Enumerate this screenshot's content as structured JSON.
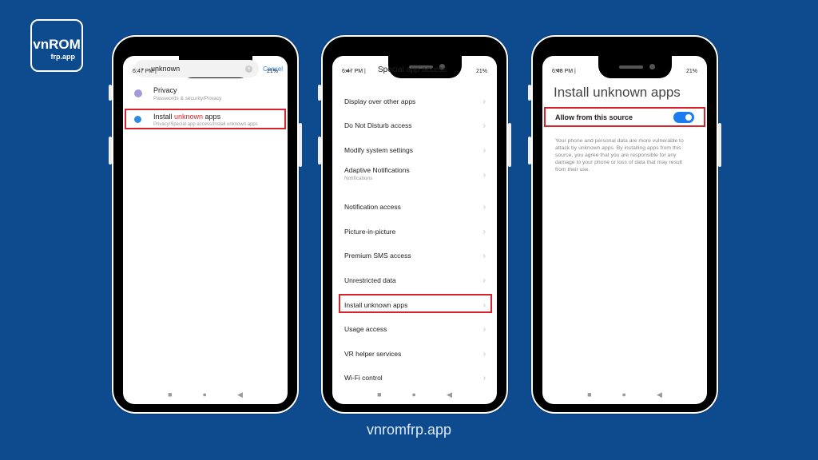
{
  "logo": {
    "main": "vnROM",
    "sub": "frp.app"
  },
  "phone1": {
    "time": "6:47 PM | ",
    "battery": "21%",
    "search_value": "unknown",
    "cancel": "Cancel",
    "results": [
      {
        "title": "Privacy",
        "subtitle": "Passwords & security/Privacy"
      },
      {
        "title_pre": "Install ",
        "title_match": "unknown",
        "title_post": " apps",
        "subtitle": "Privacy/Special app access/Install unknown apps"
      }
    ]
  },
  "phone2": {
    "time": "6:47 PM | ",
    "battery": "21%",
    "title": "Special app access",
    "items": [
      {
        "label": "Display over other apps"
      },
      {
        "label": "Do Not Disturb access"
      },
      {
        "label": "Modify system settings"
      },
      {
        "label": "Adaptive Notifications",
        "sub": "Notifications"
      },
      {
        "label": "Notification access"
      },
      {
        "label": "Picture-in-picture"
      },
      {
        "label": "Premium SMS access"
      },
      {
        "label": "Unrestricted data"
      },
      {
        "label": "Install unknown apps"
      },
      {
        "label": "Usage access"
      },
      {
        "label": "VR helper services"
      },
      {
        "label": "Wi-Fi control"
      }
    ]
  },
  "phone3": {
    "time": "6:48 PM | ",
    "battery": "21%",
    "title": "Install unknown apps",
    "toggle_label": "Allow from this source",
    "toggle_on": true,
    "description": "Your phone and personal data are more vulnerable to attack by unknown apps. By installing apps from this source, you agree that you are responsible for any damage to your phone or loss of data that may result from their use."
  },
  "footer": "vnromfrp.app",
  "colors": {
    "background": "#0d4a8e",
    "highlight": "#d8232a",
    "accent": "#1a7cf0"
  }
}
